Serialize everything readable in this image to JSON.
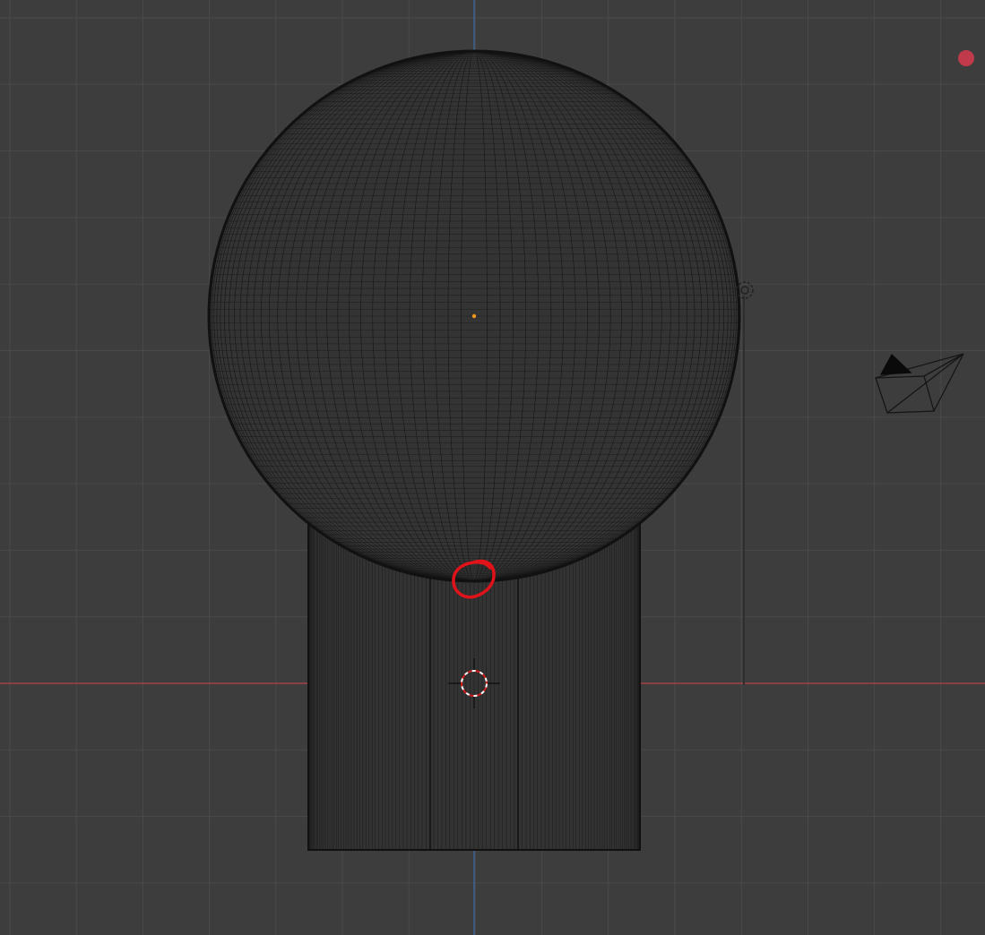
{
  "viewport": {
    "background": "#3d3d3d",
    "grid_color": "#4a4a4a",
    "x_axis_color": "#b8414a",
    "z_axis_color": "#3c6ea8",
    "wire_color": "#151515"
  },
  "objects": [
    {
      "name": "sphere",
      "type": "uv-sphere-wireframe"
    },
    {
      "name": "cylinder",
      "type": "cylinder-wireframe"
    },
    {
      "name": "camera",
      "type": "camera-gizmo"
    },
    {
      "name": "light",
      "type": "light-gizmo"
    }
  ],
  "annotation": {
    "color": "#e0131a",
    "shape": "hand-drawn-circle"
  },
  "record_indicator": {
    "color": "#c13a4b"
  },
  "icons": [
    "3d-cursor-icon",
    "origin-dot-icon",
    "camera-icon",
    "light-icon",
    "record-dot-icon"
  ]
}
